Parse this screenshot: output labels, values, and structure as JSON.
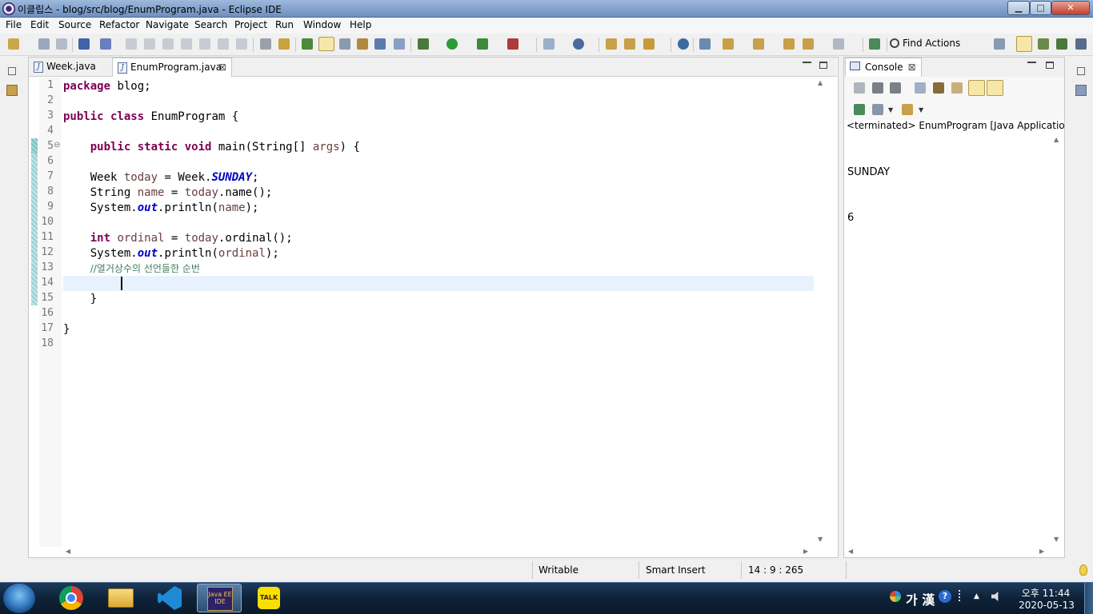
{
  "window": {
    "title": "이클립스 - blog/src/blog/EnumProgram.java - Eclipse IDE",
    "minimize": "▁",
    "maximize": "□",
    "close": "✕"
  },
  "menu": [
    "File",
    "Edit",
    "Source",
    "Refactor",
    "Navigate",
    "Search",
    "Project",
    "Run",
    "Window",
    "Help"
  ],
  "toolbar": {
    "find_actions": "Find Actions"
  },
  "editor": {
    "tabs": [
      {
        "label": "Week.java",
        "active": false,
        "icon": "java-file-icon"
      },
      {
        "label": "EnumProgram.java",
        "active": true,
        "icon": "java-file-icon",
        "close": "⊠"
      }
    ],
    "line_numbers": [
      "1",
      "2",
      "3",
      "4",
      "5",
      "6",
      "7",
      "8",
      "9",
      "10",
      "11",
      "12",
      "13",
      "14",
      "15",
      "16",
      "17",
      "18"
    ],
    "fold_marker": "⊖",
    "code": {
      "l1": {
        "kw": "package",
        "rest": " blog;"
      },
      "l3": {
        "kw": "public class",
        "rest": " EnumProgram {"
      },
      "l5": {
        "indent": "    ",
        "kw": "public static void",
        "rest": " main(String[] ",
        "var": "args",
        "end": ") {"
      },
      "l7": {
        "indent": "    ",
        "pre": "Week ",
        "var": "today",
        "mid": " = Week.",
        "stat": "SUNDAY",
        "end": ";"
      },
      "l8": {
        "indent": "    ",
        "pre": "String ",
        "var": "name",
        "mid": " = ",
        "var2": "today",
        "end": ".name();"
      },
      "l9": {
        "indent": "    ",
        "pre": "System.",
        "stat": "out",
        "mid": ".println(",
        "var": "name",
        "end": ");"
      },
      "l11": {
        "indent": "    ",
        "kw": "int",
        "mid": " ",
        "var": "ordinal",
        "mid2": " = ",
        "var2": "today",
        "end": ".ordinal();"
      },
      "l12": {
        "indent": "    ",
        "pre": "System.",
        "stat": "out",
        "mid": ".println(",
        "var": "ordinal",
        "end": ");"
      },
      "l13": {
        "indent": "    ",
        "comment": "//열거상수의 선언들한 순번"
      },
      "l15": {
        "indent": "    ",
        "rest": "}"
      },
      "l17": {
        "rest": "}"
      }
    }
  },
  "console": {
    "tab_label": "Console",
    "close": "⊠",
    "description": "<terminated> EnumProgram [Java Application] C:\\",
    "output": [
      "SUNDAY",
      "6"
    ]
  },
  "status": {
    "writable": "Writable",
    "insert_mode": "Smart Insert",
    "position": "14 : 9 : 265"
  },
  "taskbar": {
    "apps": [
      "chrome-icon",
      "file-explorer-icon",
      "vscode-icon",
      "eclipse-icon",
      "kakaotalk-icon"
    ],
    "eclipse_label": "Java EE IDE",
    "kakao_label": "TALK",
    "ime": "가 漢",
    "time": "오후 11:44",
    "date": "2020-05-13"
  },
  "colors": {
    "keyword": "#7f0055",
    "static_field": "#0000c0",
    "local_var": "#6a3e3e",
    "comment": "#3f7f5f",
    "current_line": "#e8f2fe"
  }
}
